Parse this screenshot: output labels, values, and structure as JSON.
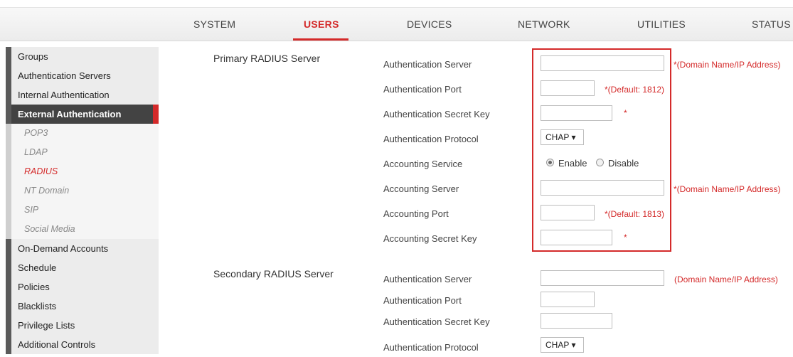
{
  "topnav": {
    "tabs": [
      {
        "label": "SYSTEM"
      },
      {
        "label": "USERS"
      },
      {
        "label": "DEVICES"
      },
      {
        "label": "NETWORK"
      },
      {
        "label": "UTILITIES"
      },
      {
        "label": "STATUS"
      }
    ],
    "active": "USERS"
  },
  "sidebar": {
    "items": [
      {
        "label": "Groups"
      },
      {
        "label": "Authentication Servers"
      },
      {
        "label": "Internal Authentication"
      },
      {
        "label": "External Authentication"
      },
      {
        "label": "POP3"
      },
      {
        "label": "LDAP"
      },
      {
        "label": "RADIUS"
      },
      {
        "label": "NT Domain"
      },
      {
        "label": "SIP"
      },
      {
        "label": "Social Media"
      },
      {
        "label": "On-Demand Accounts"
      },
      {
        "label": "Schedule"
      },
      {
        "label": "Policies"
      },
      {
        "label": "Blacklists"
      },
      {
        "label": "Privilege Lists"
      },
      {
        "label": "Additional Controls"
      }
    ]
  },
  "primary": {
    "title": "Primary RADIUS Server",
    "auth_server": {
      "label": "Authentication Server",
      "value": "",
      "note": "*(Domain Name/IP Address)"
    },
    "auth_port": {
      "label": "Authentication Port",
      "value": "",
      "note": "*(Default: 1812)"
    },
    "auth_secret": {
      "label": "Authentication Secret Key",
      "value": "",
      "note": "*"
    },
    "auth_protocol": {
      "label": "Authentication Protocol",
      "value": "CHAP ▾"
    },
    "acct_service": {
      "label": "Accounting Service",
      "enable": "Enable",
      "disable": "Disable",
      "selected": "Enable"
    },
    "acct_server": {
      "label": "Accounting Server",
      "value": "",
      "note": "*(Domain Name/IP Address)"
    },
    "acct_port": {
      "label": "Accounting Port",
      "value": "",
      "note": "*(Default: 1813)"
    },
    "acct_secret": {
      "label": "Accounting Secret Key",
      "value": "",
      "note": "*"
    }
  },
  "secondary": {
    "title": "Secondary RADIUS Server",
    "auth_server": {
      "label": "Authentication Server",
      "value": "",
      "note": "(Domain Name/IP Address)"
    },
    "auth_port": {
      "label": "Authentication Port",
      "value": ""
    },
    "auth_secret": {
      "label": "Authentication Secret Key",
      "value": ""
    },
    "auth_protocol": {
      "label": "Authentication Protocol",
      "value": "CHAP ▾"
    }
  },
  "colors": {
    "accent": "#d42a2a",
    "sidebar_selected": "#434343"
  }
}
